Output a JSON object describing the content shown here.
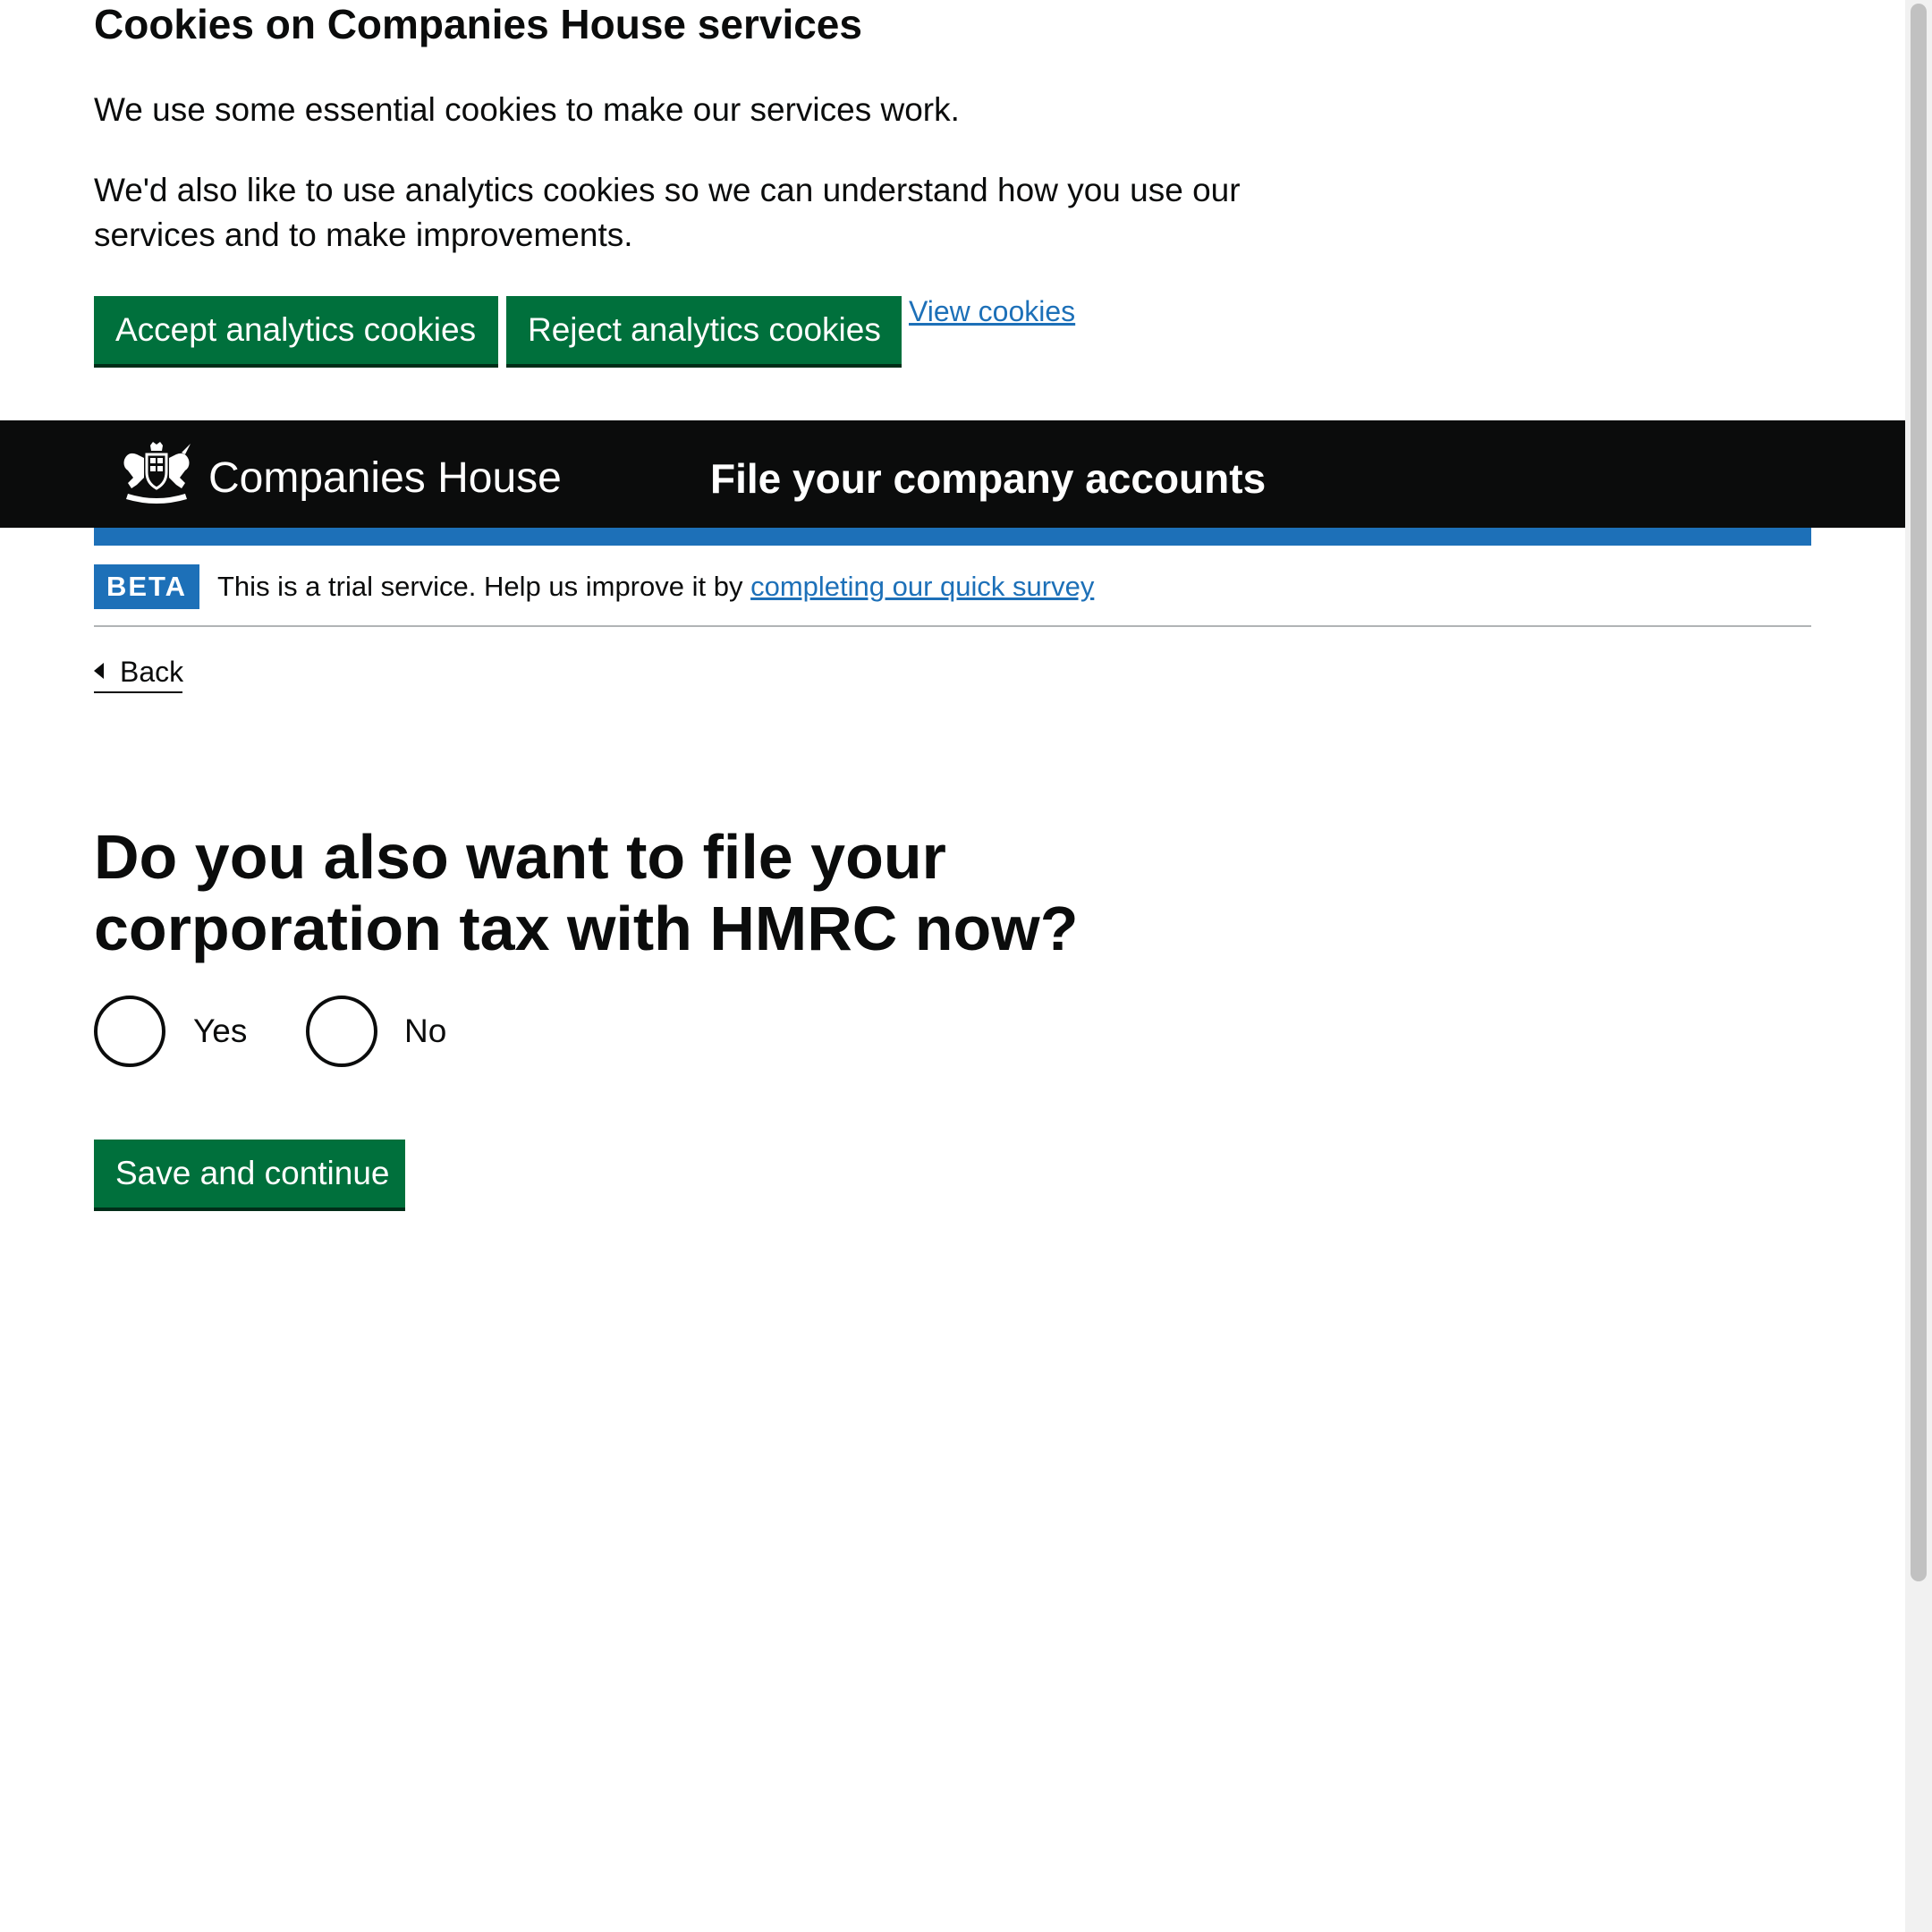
{
  "cookie_banner": {
    "title": "Cookies on Companies House services",
    "paragraph_1": "We use some essential cookies to make our services work.",
    "paragraph_2": "We'd also like to use analytics cookies so we can understand how you use our services and to make improvements.",
    "accept_label": "Accept analytics cookies",
    "reject_label": "Reject analytics cookies",
    "view_label": "View cookies"
  },
  "header": {
    "organisation": "Companies House",
    "service_name": "File your company accounts",
    "crest_icon": "royal-coat-of-arms-icon"
  },
  "phase_banner": {
    "tag": "BETA",
    "text": "This is a trial service. Help us improve it by",
    "link": "completing our quick survey"
  },
  "navigation": {
    "back_label": "Back"
  },
  "form": {
    "question": "Do you also want to file your corporation tax with HMRC now?",
    "options": [
      {
        "label": "Yes",
        "selected": false
      },
      {
        "label": "No",
        "selected": false
      }
    ],
    "submit_label": "Save and continue"
  },
  "colors": {
    "button_green": "#00703c",
    "link_blue": "#1d70b8",
    "header_black": "#0b0c0c"
  }
}
